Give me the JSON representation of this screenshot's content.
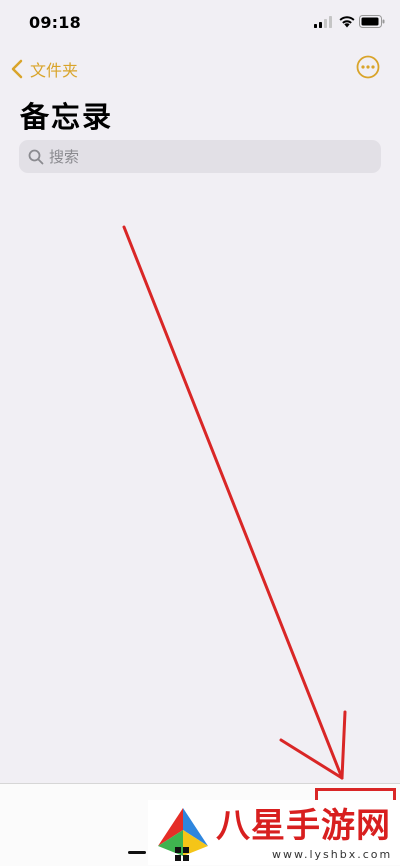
{
  "status_bar": {
    "time": "09:18"
  },
  "nav": {
    "back_label": "文件夹"
  },
  "page": {
    "title": "备忘录"
  },
  "search": {
    "placeholder": "搜索"
  },
  "colors": {
    "accent": "#d9a42a",
    "background": "#f1eff4",
    "annotation": "#d92626"
  },
  "icons": [
    "signal-icon",
    "wifi-icon",
    "battery-icon",
    "chevron-left-icon",
    "more-circle-icon",
    "search-icon",
    "compose-icon"
  ],
  "watermark": {
    "name": "八星手游网",
    "url": "www.lyshbx.com"
  }
}
